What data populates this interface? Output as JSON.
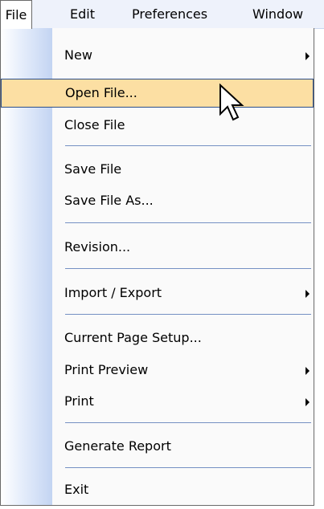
{
  "menubar": {
    "items": [
      {
        "label": "File"
      },
      {
        "label": "Edit"
      },
      {
        "label": "Preferences"
      },
      {
        "label": "Window"
      }
    ]
  },
  "file_menu": {
    "items": [
      {
        "label": "New",
        "submenu": true
      },
      {
        "label": "Open File...",
        "highlighted": true
      },
      {
        "label": "Close File"
      },
      {
        "label": "Save File"
      },
      {
        "label": "Save File As..."
      },
      {
        "label": "Revision..."
      },
      {
        "label": "Import / Export",
        "submenu": true
      },
      {
        "label": "Current Page Setup..."
      },
      {
        "label": "Print Preview",
        "submenu": true
      },
      {
        "label": "Print",
        "submenu": true
      },
      {
        "label": "Generate Report"
      },
      {
        "label": "Exit"
      }
    ]
  },
  "colors": {
    "highlight_fill": "#fcdfa3",
    "highlight_border": "#2b4e8a",
    "separator": "#7590c3",
    "gutter": "#c3d4f2"
  },
  "icons": {
    "submenu_arrow": "triangle-right",
    "cursor": "mouse-pointer"
  }
}
